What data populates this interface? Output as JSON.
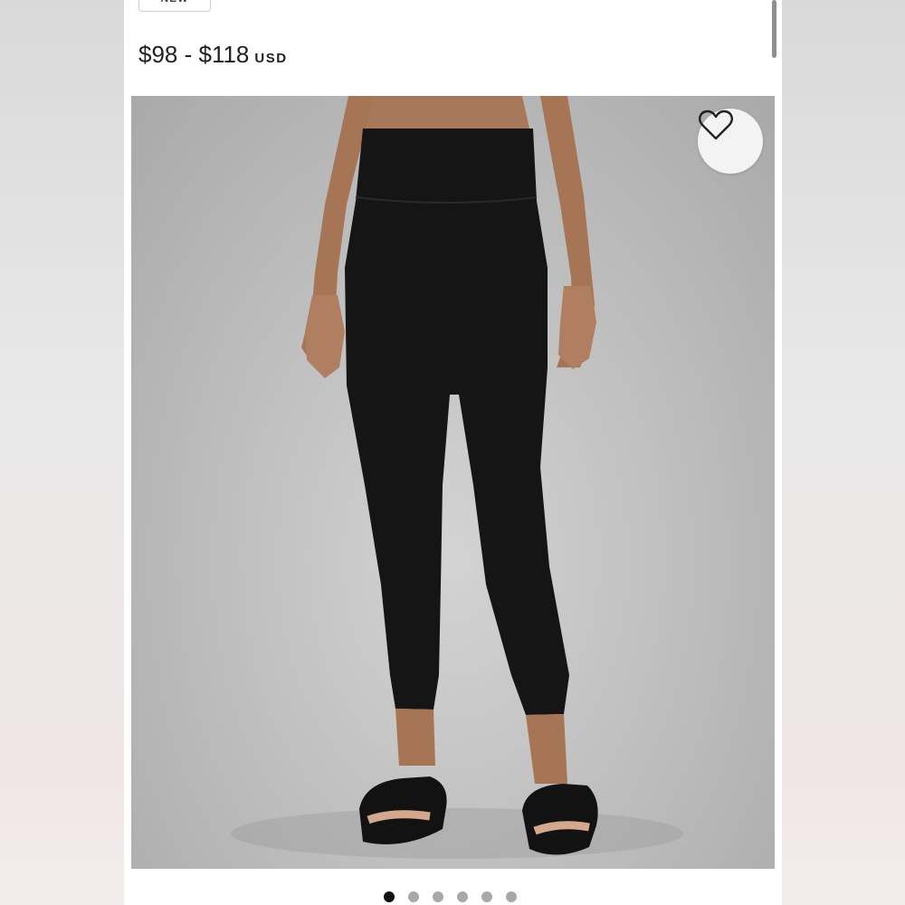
{
  "product": {
    "badge": "NEW",
    "price": "$98 - $118",
    "currency": "USD",
    "image_icon": "product-photo-leggings",
    "favorite_icon": "heart-outline-icon"
  },
  "carousel": {
    "count": 6,
    "active_index": 0
  },
  "colors": {
    "active_dot": "#111111",
    "inactive_dot": "#a8a8a8",
    "legging": "#151515"
  }
}
